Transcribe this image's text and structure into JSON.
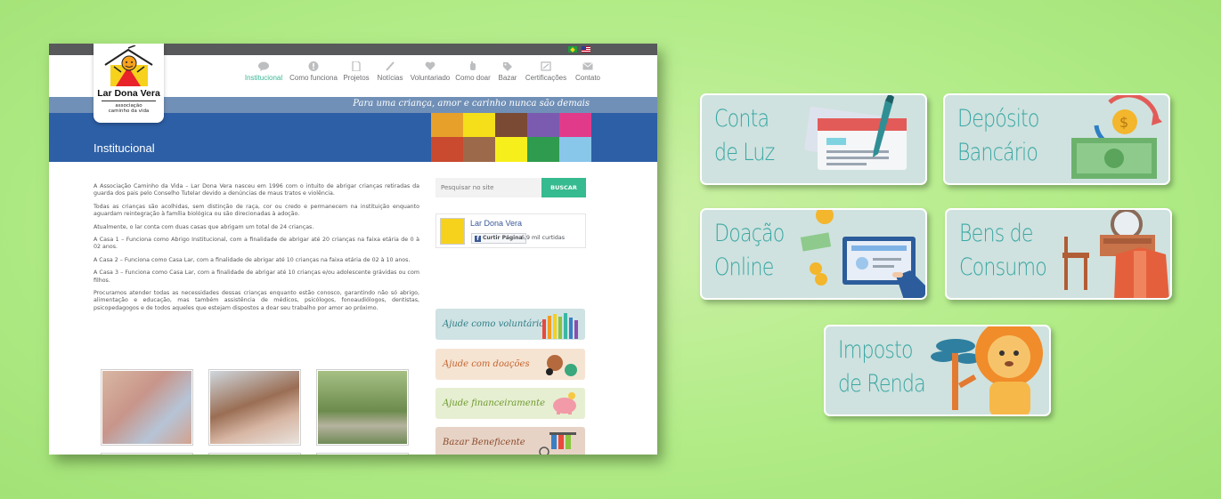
{
  "site": {
    "logo": {
      "name": "Lar Dona Vera",
      "sub_line1": "associação",
      "sub_line2": "caminho da vida"
    },
    "nav": [
      {
        "label": "Institucional",
        "icon": "speech-bubble-icon",
        "active": true
      },
      {
        "label": "Como funciona",
        "icon": "exclamation-icon"
      },
      {
        "label": "Projetos",
        "icon": "document-icon"
      },
      {
        "label": "Notícias",
        "icon": "pencil-icon"
      },
      {
        "label": "Voluntariado",
        "icon": "heart-icon"
      },
      {
        "label": "Como doar",
        "icon": "hand-icon"
      },
      {
        "label": "Bazar",
        "icon": "tag-icon"
      },
      {
        "label": "Certificações",
        "icon": "certificate-icon"
      },
      {
        "label": "Contato",
        "icon": "envelope-icon"
      }
    ],
    "tagline": "Para uma criança, amor e carinho nunca são demais",
    "page_title": "Institucional",
    "paragraphs": [
      "A Associação Caminho da Vida – Lar Dona Vera nasceu em 1996 com o intuito de abrigar crianças retiradas da guarda dos pais pelo Conselho Tutelar devido a denúncias de maus tratos e violência.",
      "Todas as crianças são acolhidas, sem distinção de raça, cor ou credo e permanecem na instituição enquanto aguardam reintegração à família biológica ou são direcionadas à adoção.",
      "Atualmente, o lar conta com duas casas que abrigam um total de 24 crianças.",
      "A Casa 1 – Funciona como Abrigo Institucional, com a finalidade de abrigar até 20 crianças na faixa etária de 0 à 02 anos.",
      "A Casa 2 – Funciona como Casa Lar, com a finalidade de abrigar até 10 crianças na faixa etária de 02 à 10 anos.",
      "A Casa 3 – Funciona como Casa Lar, com a finalidade de abrigar até 10 crianças e/ou adolescente grávidas ou com filhos.",
      "Procuramos atender todas as necessidades dessas crianças enquanto estão conosco, garantindo não só abrigo, alimentação e educação, mas também assistência de médicos, psicólogos, fonoaudiólogos, dentistas, psicopedagogos e de todos aqueles que estejam dispostos a doar seu trabalho por amor ao próximo."
    ],
    "search": {
      "placeholder": "Pesquisar no site",
      "button": "BUSCAR"
    },
    "facebook": {
      "page_name": "Lar Dona Vera",
      "like_label": "Curtir Página",
      "likes": "6,9 mil curtidas"
    },
    "help_buttons": [
      "Ajude como voluntário",
      "Ajude com doações",
      "Ajude financeiramente",
      "Bazar Beneficente"
    ]
  },
  "cards": [
    {
      "line1": "Conta",
      "line2": "de Luz",
      "icon": "bill-pen-icon"
    },
    {
      "line1": "Depósito",
      "line2": "Bancário",
      "icon": "money-transfer-icon"
    },
    {
      "line1": "Doação",
      "line2": "Online",
      "icon": "online-payment-icon"
    },
    {
      "line1": "Bens de",
      "line2": "Consumo",
      "icon": "furniture-clothes-icon"
    },
    {
      "line1": "Imposto",
      "line2": "de Renda",
      "icon": "lion-icon"
    }
  ],
  "colors": {
    "card_text": "#3aa7a4",
    "card_bg": "#cfe2df",
    "accent": "#36ba8f",
    "banner": "#2d5fa6"
  }
}
